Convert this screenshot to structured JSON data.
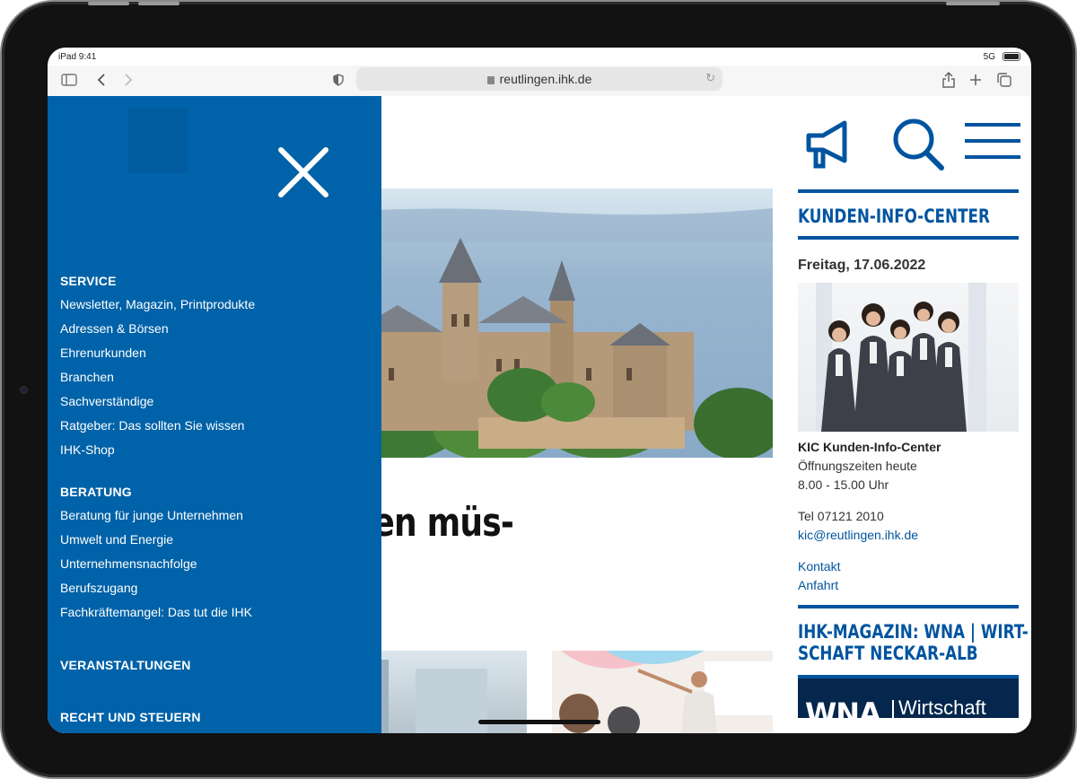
{
  "status": {
    "time": "iPad 9:41",
    "network": "5G"
  },
  "browser": {
    "url": "reutlingen.ihk.de"
  },
  "main": {
    "headline": "Landkreise wissen müs-"
  },
  "menu": {
    "sections": [
      {
        "title": "SERVICE",
        "items": [
          "Newsletter, Magazin, Printprodukte",
          "Adressen & Börsen",
          "Ehrenurkunden",
          "Branchen",
          "Sachverständige",
          "Ratgeber: Das sollten Sie wissen",
          "IHK-Shop"
        ]
      },
      {
        "title": "BERATUNG",
        "items": [
          "Beratung für junge Unternehmen",
          "Umwelt und Energie",
          "Unternehmensnachfolge",
          "Berufszugang",
          "Fachkräftemangel: Das tut die IHK"
        ]
      },
      {
        "title": "VERANSTALTUNGEN",
        "items": []
      },
      {
        "title": "RECHT UND STEUERN",
        "items": []
      }
    ]
  },
  "kic": {
    "title": "KUNDEN-INFO-CENTER",
    "date": "Freitag, 17.06.2022",
    "name": "KIC Kunden-Info-Center",
    "hours_label": "Öffnungszeiten heute",
    "hours": "8.00 - 15.00 Uhr",
    "phone": "Tel 07121 2010",
    "email": "kic@reutlingen.ihk.de",
    "contact": "Kontakt",
    "directions": "Anfahrt"
  },
  "magazine": {
    "title_line1": "IHK-MAGAZIN: WNA | WIRT-",
    "title_line2": "SCHAFT NECKAR-ALB",
    "banner_left": "WNA",
    "banner_right": "Wirtschaft"
  },
  "colors": {
    "brand": "#00549f",
    "menu_bg": "#0062a8"
  }
}
